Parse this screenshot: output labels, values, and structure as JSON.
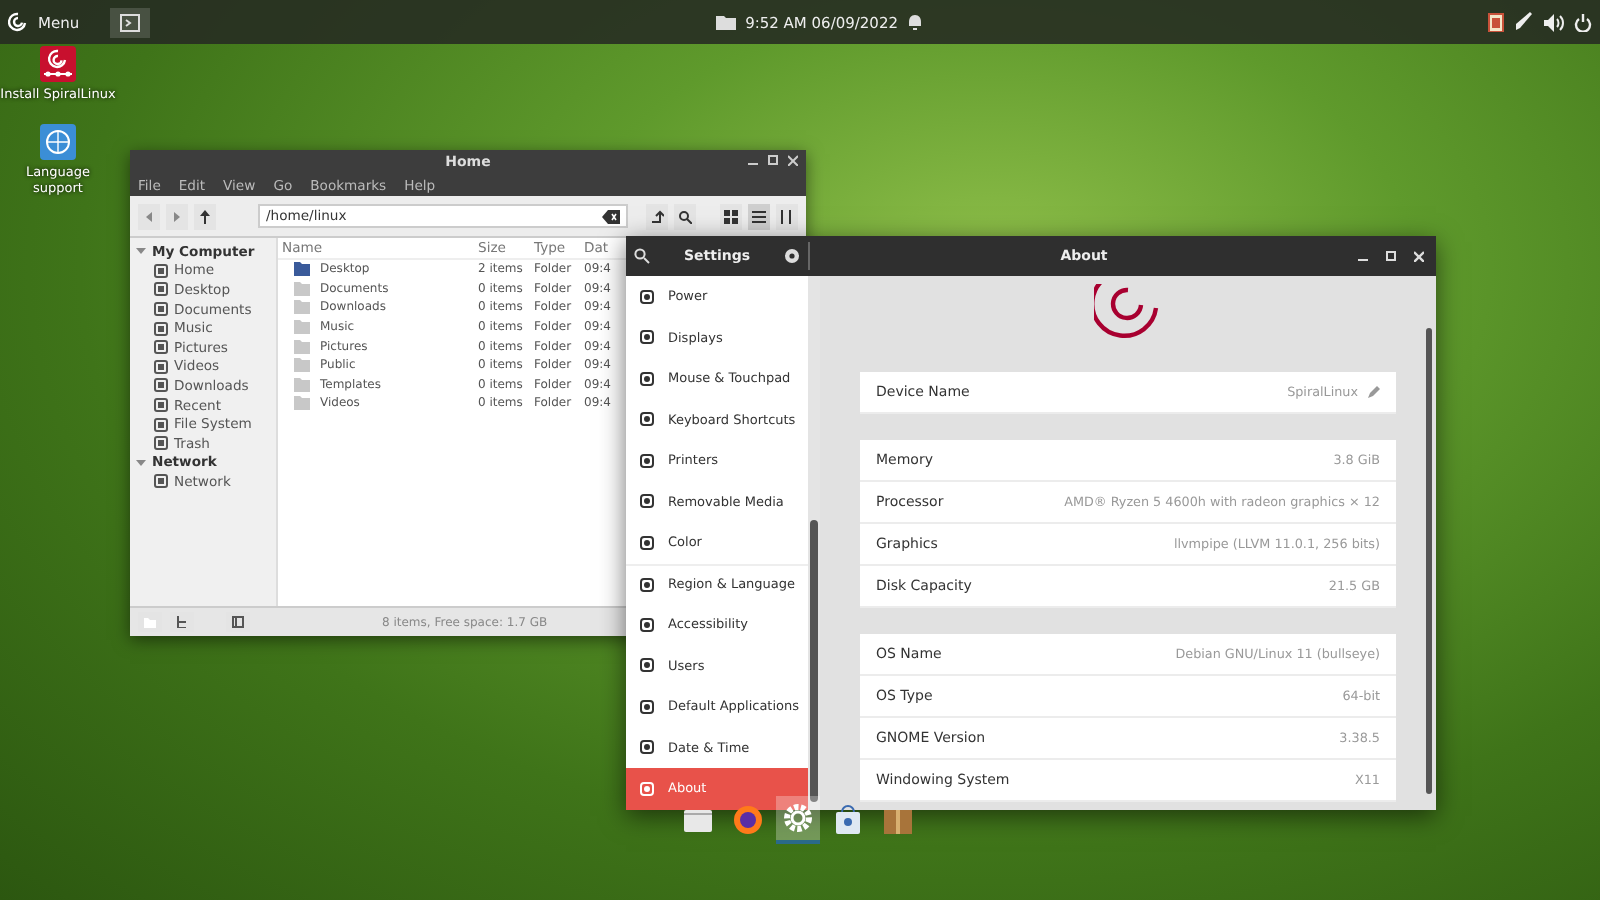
{
  "top_panel": {
    "menu_label": "Menu",
    "clock": "9:52 AM 06/09/2022"
  },
  "desktop_icons": [
    {
      "kind": "installer",
      "label": "Install SpiralLinux"
    },
    {
      "kind": "language",
      "label": "Language support"
    }
  ],
  "file_manager": {
    "title": "Home",
    "menu": [
      "File",
      "Edit",
      "View",
      "Go",
      "Bookmarks",
      "Help"
    ],
    "path": "/home/linux",
    "sidebar": [
      {
        "label": "My Computer",
        "expanded": true,
        "children": [
          {
            "label": "Home"
          },
          {
            "label": "Desktop"
          },
          {
            "label": "Documents"
          },
          {
            "label": "Music"
          },
          {
            "label": "Pictures"
          },
          {
            "label": "Videos"
          },
          {
            "label": "Downloads"
          },
          {
            "label": "Recent"
          },
          {
            "label": "File System"
          },
          {
            "label": "Trash"
          }
        ]
      },
      {
        "label": "Network",
        "expanded": true,
        "children": [
          {
            "label": "Network"
          }
        ]
      }
    ],
    "columns": [
      "Name",
      "Size",
      "Type",
      "Dat"
    ],
    "rows": [
      [
        "Desktop",
        "2 items",
        "Folder",
        "09:4"
      ],
      [
        "Documents",
        "0 items",
        "Folder",
        "09:4"
      ],
      [
        "Downloads",
        "0 items",
        "Folder",
        "09:4"
      ],
      [
        "Music",
        "0 items",
        "Folder",
        "09:4"
      ],
      [
        "Pictures",
        "0 items",
        "Folder",
        "09:4"
      ],
      [
        "Public",
        "0 items",
        "Folder",
        "09:4"
      ],
      [
        "Templates",
        "0 items",
        "Folder",
        "09:4"
      ],
      [
        "Videos",
        "0 items",
        "Folder",
        "09:4"
      ]
    ],
    "status": "8 items, Free space: 1.7 GB"
  },
  "settings": {
    "title": "Settings",
    "panel_title": "About",
    "nav": [
      {
        "label": "Power",
        "selected": false
      },
      {
        "label": "Displays",
        "selected": false
      },
      {
        "label": "Mouse & Touchpad",
        "selected": false
      },
      {
        "label": "Keyboard Shortcuts",
        "selected": false
      },
      {
        "label": "Printers",
        "selected": false
      },
      {
        "label": "Removable Media",
        "selected": false
      },
      {
        "label": "Color",
        "selected": false
      },
      {
        "label": "Region & Language",
        "selected": false
      },
      {
        "label": "Accessibility",
        "selected": false
      },
      {
        "label": "Users",
        "selected": false
      },
      {
        "label": "Default Applications",
        "selected": false
      },
      {
        "label": "Date & Time",
        "selected": false
      },
      {
        "label": "About",
        "selected": true
      }
    ],
    "device_name": {
      "label": "Device Name",
      "value": "SpiralLinux"
    },
    "groups": [
      [
        {
          "label": "Memory",
          "value": "3.8 GiB"
        },
        {
          "label": "Processor",
          "value": "AMD® Ryzen 5 4600h with radeon graphics × 12"
        },
        {
          "label": "Graphics",
          "value": "llvmpipe (LLVM 11.0.1, 256 bits)"
        },
        {
          "label": "Disk Capacity",
          "value": "21.5 GB"
        }
      ],
      [
        {
          "label": "OS Name",
          "value": "Debian GNU/Linux 11 (bullseye)"
        },
        {
          "label": "OS Type",
          "value": "64-bit"
        },
        {
          "label": "GNOME Version",
          "value": "3.38.5"
        },
        {
          "label": "Windowing System",
          "value": "X11"
        }
      ]
    ]
  },
  "dock": [
    {
      "kind": "files",
      "active": false
    },
    {
      "kind": "browser",
      "active": false
    },
    {
      "kind": "settings",
      "active": true
    },
    {
      "kind": "store",
      "active": false
    },
    {
      "kind": "archive",
      "active": false
    }
  ]
}
